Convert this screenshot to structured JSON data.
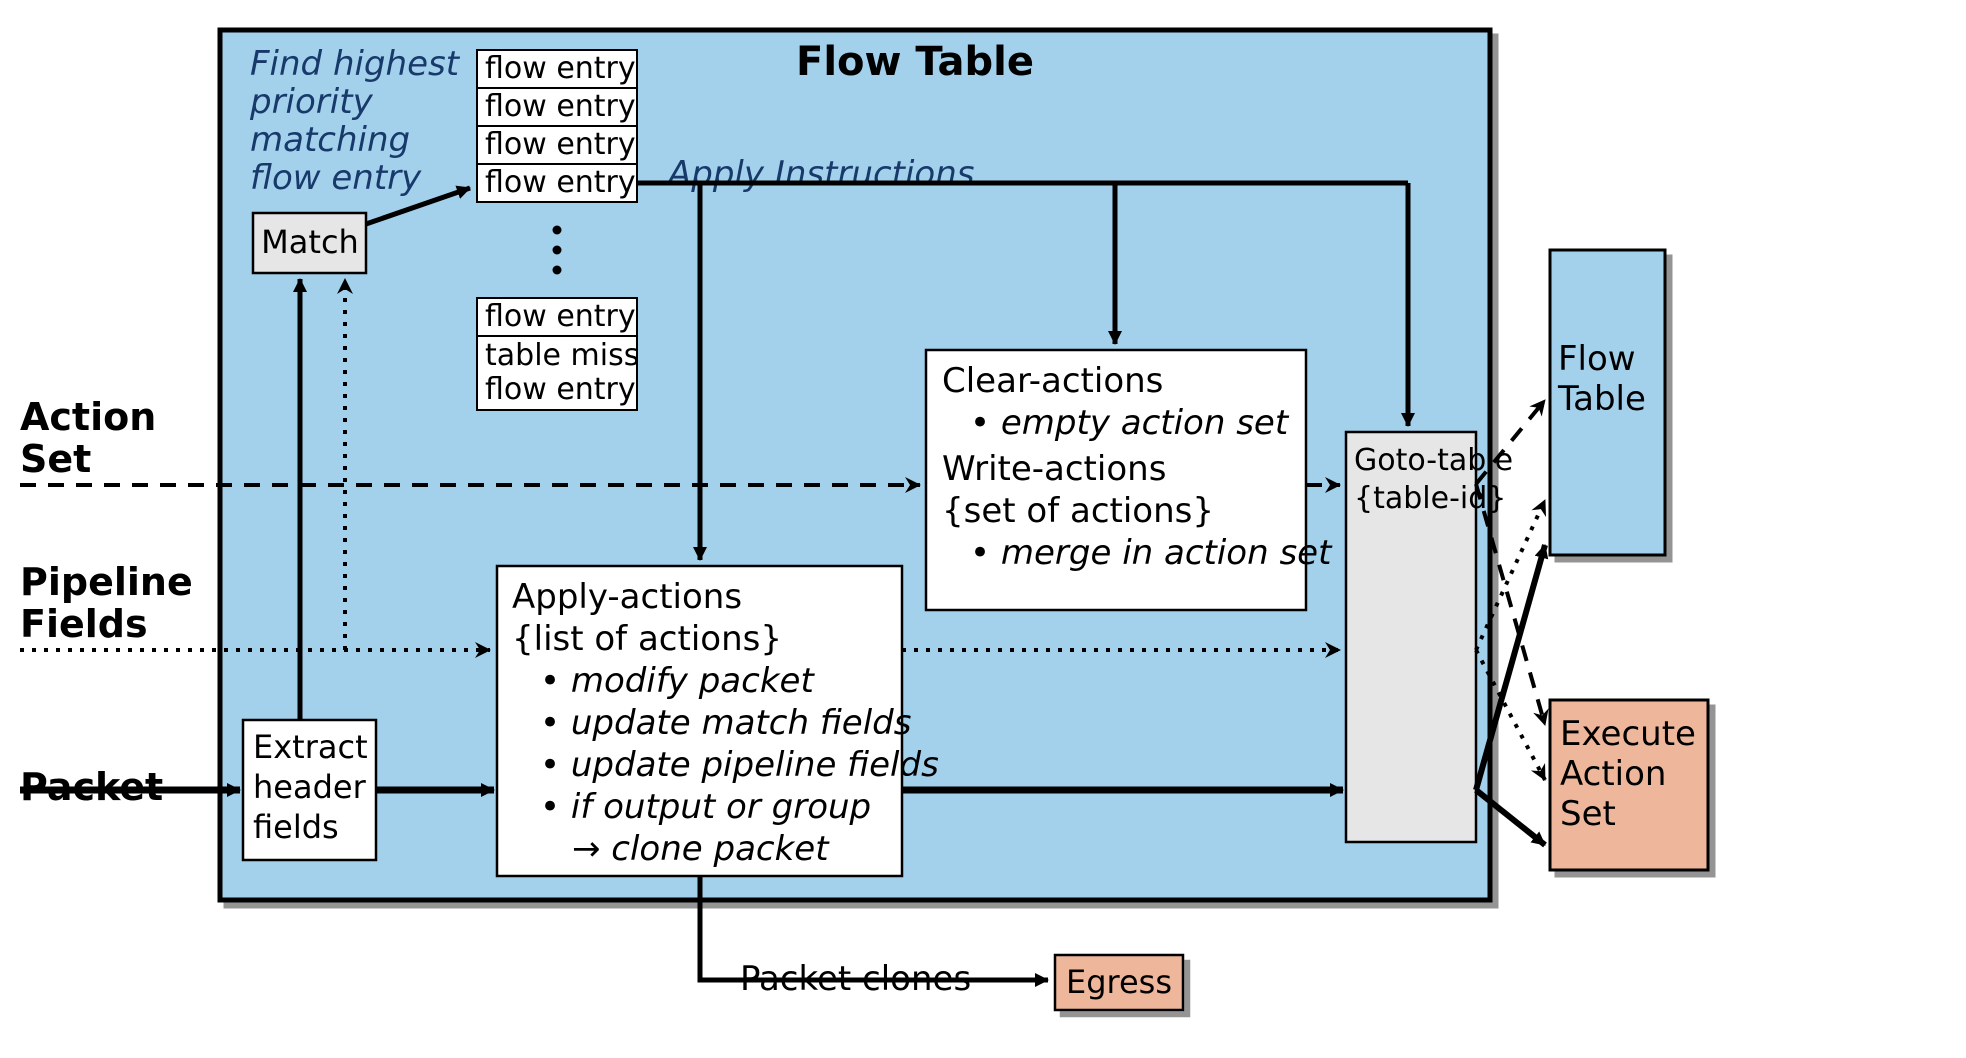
{
  "title": "Flow Table",
  "leftLabels": {
    "actionSet": "Action\nSet",
    "pipelineFields": "Pipeline\nFields",
    "packet": "Packet"
  },
  "annotations": {
    "findHighest": "Find highest\npriority\nmatching\nflow entry",
    "applyInstructions": "Apply Instructions",
    "packetClones": "Packet clones"
  },
  "boxes": {
    "match": "Match",
    "extract": "Extract\nheader\nfields",
    "applyActions": {
      "title": "Apply-actions",
      "subtitle": "{list of actions}",
      "bullets": [
        "modify packet",
        "update match fields",
        "update pipeline fields",
        "if output or group"
      ],
      "lastLine": "→ clone packet"
    },
    "clearWrite": {
      "title1": "Clear-actions",
      "bullet1": "empty action set",
      "title2": "Write-actions",
      "subtitle2": "{set of actions}",
      "bullet2": "merge in action set"
    },
    "gotoTable": "Goto-table\n{table-id}",
    "egress": "Egress",
    "flowTableNext": "Flow\nTable",
    "executeActionSet": "Execute\nAction\nSet"
  },
  "flowEntries": {
    "top": [
      "flow entry",
      "flow entry",
      "flow entry",
      "flow entry"
    ],
    "bottom": [
      "flow entry",
      "table miss\nflow entry"
    ]
  }
}
